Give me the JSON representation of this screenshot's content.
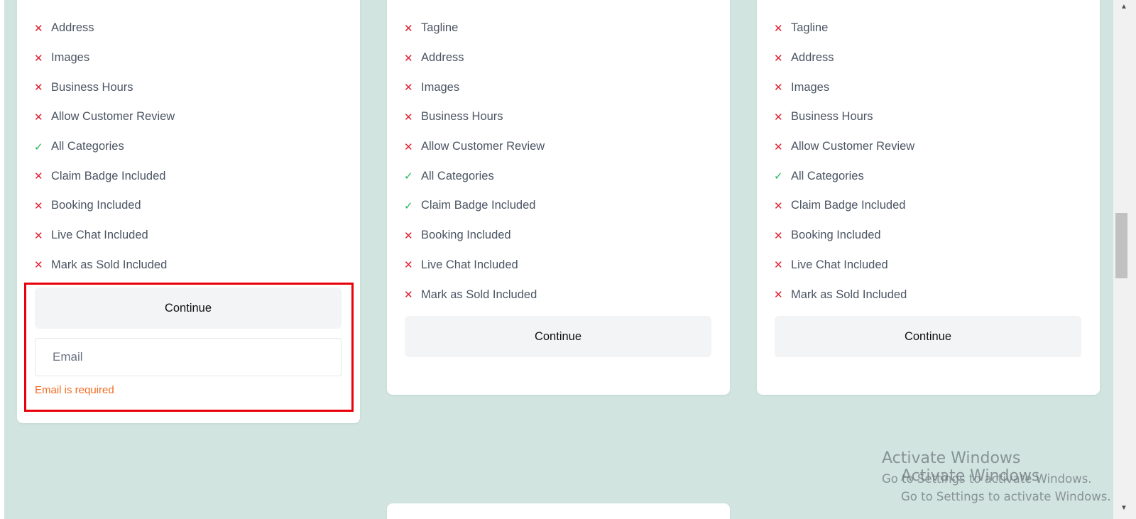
{
  "cards": [
    {
      "features": [
        {
          "label": "Address",
          "included": false
        },
        {
          "label": "Images",
          "included": false
        },
        {
          "label": "Business Hours",
          "included": false
        },
        {
          "label": "Allow Customer Review",
          "included": false
        },
        {
          "label": "All Categories",
          "included": true
        },
        {
          "label": "Claim Badge Included",
          "included": false
        },
        {
          "label": "Booking Included",
          "included": false
        },
        {
          "label": "Live Chat Included",
          "included": false
        },
        {
          "label": "Mark as Sold Included",
          "included": false
        }
      ],
      "continue_label": "Continue",
      "email_placeholder": "Email",
      "email_value": "",
      "email_error": "Email is required"
    },
    {
      "features": [
        {
          "label": "Tagline",
          "included": false
        },
        {
          "label": "Address",
          "included": false
        },
        {
          "label": "Images",
          "included": false
        },
        {
          "label": "Business Hours",
          "included": false
        },
        {
          "label": "Allow Customer Review",
          "included": false
        },
        {
          "label": "All Categories",
          "included": true
        },
        {
          "label": "Claim Badge Included",
          "included": true
        },
        {
          "label": "Booking Included",
          "included": false
        },
        {
          "label": "Live Chat Included",
          "included": false
        },
        {
          "label": "Mark as Sold Included",
          "included": false
        }
      ],
      "continue_label": "Continue"
    },
    {
      "features": [
        {
          "label": "Tagline",
          "included": false
        },
        {
          "label": "Address",
          "included": false
        },
        {
          "label": "Images",
          "included": false
        },
        {
          "label": "Business Hours",
          "included": false
        },
        {
          "label": "Allow Customer Review",
          "included": false
        },
        {
          "label": "All Categories",
          "included": true
        },
        {
          "label": "Claim Badge Included",
          "included": false
        },
        {
          "label": "Booking Included",
          "included": false
        },
        {
          "label": "Live Chat Included",
          "included": false
        },
        {
          "label": "Mark as Sold Included",
          "included": false
        }
      ],
      "continue_label": "Continue"
    }
  ],
  "icons": {
    "included": "check-icon",
    "excluded": "x-icon"
  },
  "colors": {
    "page_background": "#d1e4df",
    "excluded_mark": "#e11d2e",
    "included_mark": "#22b45a",
    "error_text": "#f26b21",
    "highlight_border": "#e8000a"
  },
  "watermark": {
    "title": "Activate Windows",
    "subtitle": "Go to Settings to activate Windows."
  }
}
